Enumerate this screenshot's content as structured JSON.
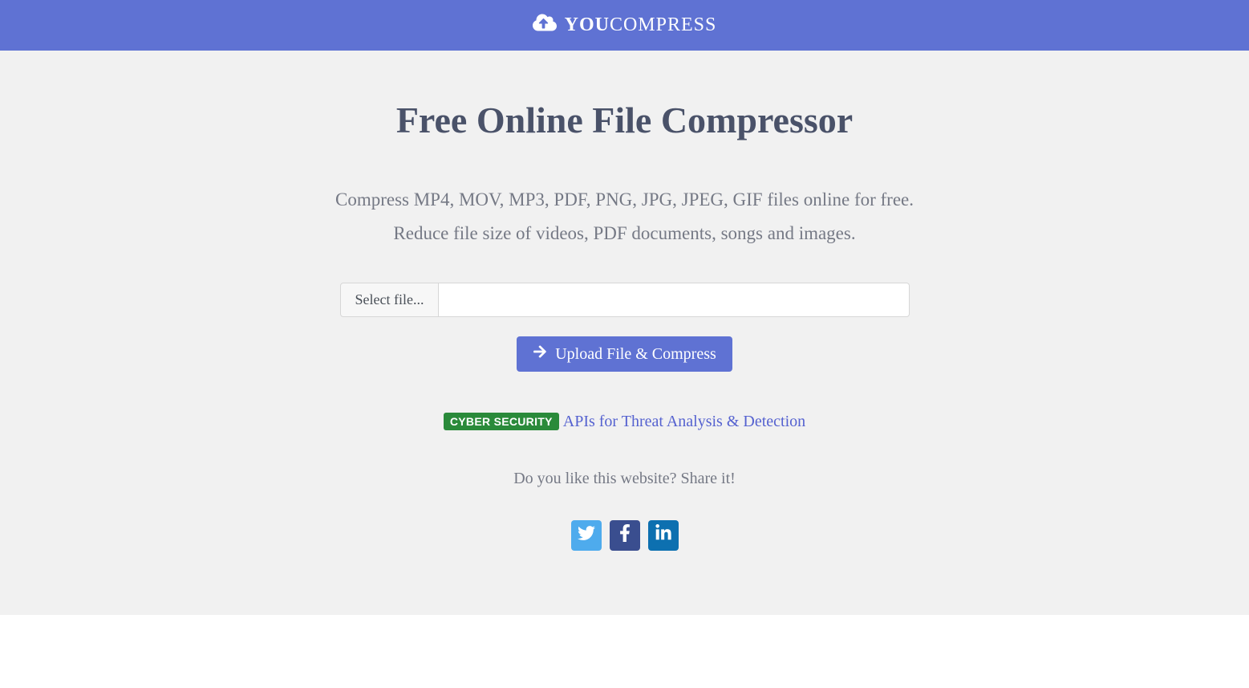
{
  "header": {
    "logo_bold": "YOU",
    "logo_light": "COMPRESS"
  },
  "main": {
    "title": "Free Online File Compressor",
    "subtitle1": "Compress MP4, MOV, MP3, PDF, PNG, JPG, JPEG, GIF files online for free.",
    "subtitle2": "Reduce file size of videos, PDF documents, songs and images.",
    "select_file_label": "Select file...",
    "upload_button_label": "Upload File & Compress",
    "badge_text": "CYBER SECURITY",
    "promo_link_text": "APIs for Threat Analysis & Detection",
    "share_prompt": "Do you like this website? Share it!"
  }
}
